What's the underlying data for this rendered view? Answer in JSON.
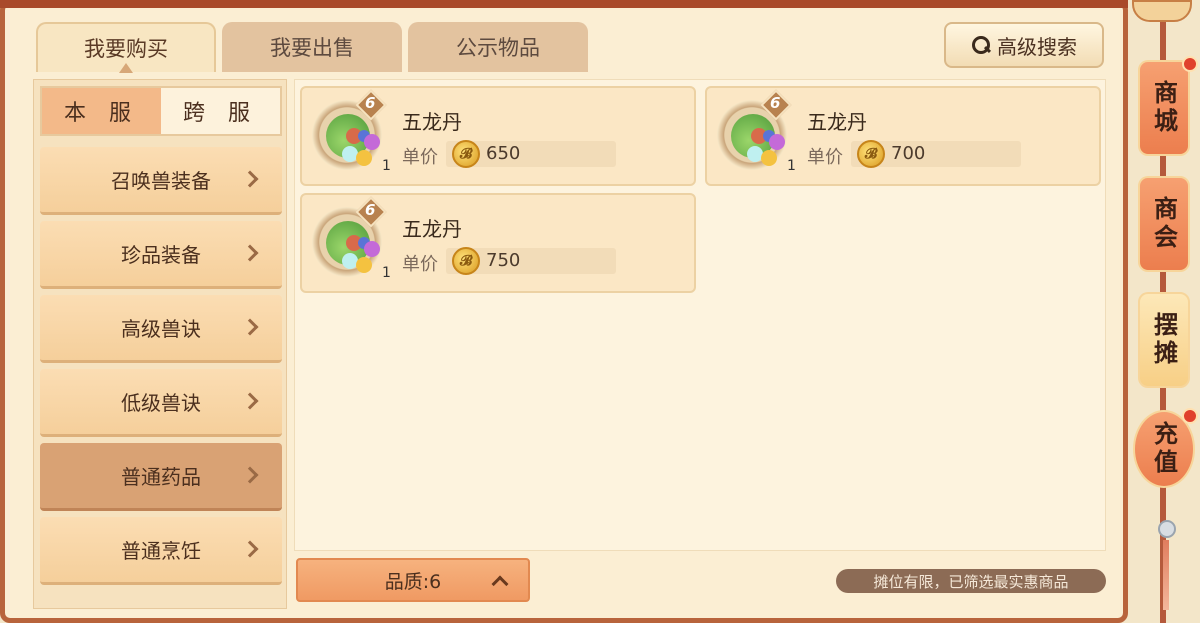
{
  "tabs": [
    {
      "label": "我要购买",
      "active": true
    },
    {
      "label": "我要出售",
      "active": false
    },
    {
      "label": "公示物品",
      "active": false
    }
  ],
  "advanced_search": {
    "label": "高级搜索",
    "icon": "search-icon"
  },
  "server_toggle": {
    "left": "本 服",
    "right": "跨 服",
    "selected": "本 服"
  },
  "categories": [
    {
      "label": "召唤兽装备",
      "selected": false
    },
    {
      "label": "珍品装备",
      "selected": false
    },
    {
      "label": "高级兽诀",
      "selected": false
    },
    {
      "label": "低级兽诀",
      "selected": false
    },
    {
      "label": "普通药品",
      "selected": true
    },
    {
      "label": "普通烹饪",
      "selected": false
    }
  ],
  "listings": [
    {
      "name": "五龙丹",
      "level": "6",
      "quantity": "1",
      "price_label": "单价",
      "price": "650",
      "coin_glyph": "𝓑"
    },
    {
      "name": "五龙丹",
      "level": "6",
      "quantity": "1",
      "price_label": "单价",
      "price": "700",
      "coin_glyph": "𝓑"
    },
    {
      "name": "五龙丹",
      "level": "6",
      "quantity": "1",
      "price_label": "单价",
      "price": "750",
      "coin_glyph": "𝓑"
    }
  ],
  "quality_filter": {
    "label": "品质:6"
  },
  "notice": "摊位有限，已筛选最实惠商品",
  "right_rail": [
    {
      "label": "商城",
      "badge": true,
      "active": false
    },
    {
      "label": "商会",
      "badge": false,
      "active": false
    },
    {
      "label": "摆摊",
      "badge": false,
      "active": true
    },
    {
      "label": "充值",
      "badge": true,
      "active": false
    }
  ],
  "colors": {
    "accent": "#f09a63",
    "frame": "#b8643c",
    "background": "#fbeed3"
  }
}
